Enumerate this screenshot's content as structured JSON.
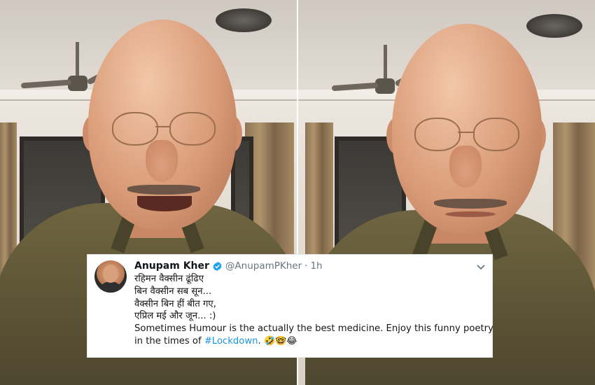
{
  "tweet": {
    "name": "Anupam Kher",
    "handle": "@AnupamPKher",
    "separator": "·",
    "time": "1h",
    "lines": [
      "रहिमन वैक्सीन ढूंढिए",
      "बिन वैक्सीन सब सून...",
      "वैक्सीन बिन हीं बीत गए,",
      "एप्रिल मई और जून... :)",
      "Sometimes Humour is the actually the best medicine. Enjoy this funny poetry"
    ],
    "last_line_prefix": "in the times of ",
    "hashtag": "#Lockdown",
    "last_line_suffix": ".",
    "emojis": "🤣🤓😂",
    "colors": {
      "hashtag": "#1b95e0",
      "verified_badge": "#1da1f2",
      "secondary_text": "#657786"
    }
  },
  "icons": {
    "verified": "verified-badge-icon",
    "menu": "chevron-down-icon",
    "avatar": "user-avatar"
  }
}
